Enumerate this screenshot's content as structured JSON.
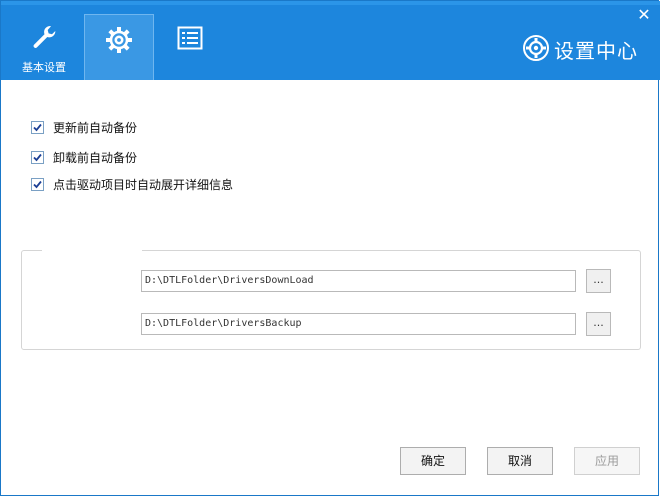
{
  "header": {
    "tabs": [
      {
        "label": "基本设置",
        "icon": "wrench-icon"
      },
      {
        "label": "",
        "icon": "gear-icon"
      },
      {
        "label": "",
        "icon": "list-icon"
      }
    ],
    "brand_title": "设置中心",
    "close_symbol": "✕"
  },
  "options": [
    {
      "label": "更新前自动备份",
      "checked": true
    },
    {
      "label": "卸载前自动备份",
      "checked": true
    },
    {
      "label": "点击驱动项目时自动展开详细信息",
      "checked": true
    }
  ],
  "paths": {
    "download_path": "D:\\DTLFolder\\DriversDownLoad",
    "backup_path": "D:\\DTLFolder\\DriversBackup",
    "browse_label": "..."
  },
  "footer": {
    "ok_label": "确定",
    "cancel_label": "取消",
    "apply_label": "应用"
  },
  "colors": {
    "header": "#1d86dd",
    "active_tab": "#3a98e4"
  }
}
